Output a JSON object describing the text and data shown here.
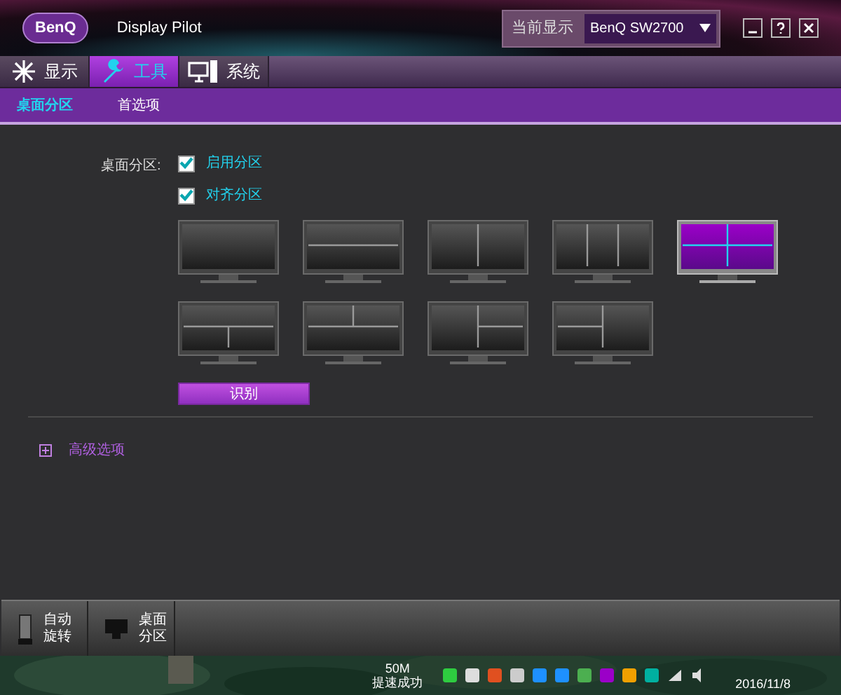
{
  "window": {
    "logo": "BenQ",
    "title": "Display Pilot",
    "monitor_label": "当前显示",
    "monitor_value": "BenQ SW2700"
  },
  "tabs": [
    {
      "label": "显示",
      "selected": false
    },
    {
      "label": "工具",
      "selected": true
    },
    {
      "label": "系统",
      "selected": false
    }
  ],
  "subtabs": [
    {
      "label": "桌面分区",
      "selected": true
    },
    {
      "label": "首选项",
      "selected": false
    }
  ],
  "partition": {
    "label": "桌面分区:",
    "options": [
      {
        "label": "启用分区",
        "checked": true
      },
      {
        "label": "对齐分区",
        "checked": true
      }
    ],
    "layouts": [
      {
        "kind": "full",
        "selected": false
      },
      {
        "kind": "h2",
        "selected": false
      },
      {
        "kind": "v2",
        "selected": false
      },
      {
        "kind": "v3",
        "selected": false
      },
      {
        "kind": "quad",
        "selected": true
      },
      {
        "kind": "top1bottom2",
        "selected": false
      },
      {
        "kind": "top2bottom1",
        "selected": false
      },
      {
        "kind": "left1right2",
        "selected": false
      },
      {
        "kind": "left2right1",
        "selected": false
      }
    ],
    "identify_button": "识别"
  },
  "advanced": {
    "label": "高级选项",
    "expanded": false
  },
  "dock": [
    {
      "label": "自动旋转"
    },
    {
      "label": "桌面分区"
    }
  ],
  "taskbar": {
    "speed": "50M",
    "speed_status": "提速成功",
    "date": "2016/11/8"
  }
}
